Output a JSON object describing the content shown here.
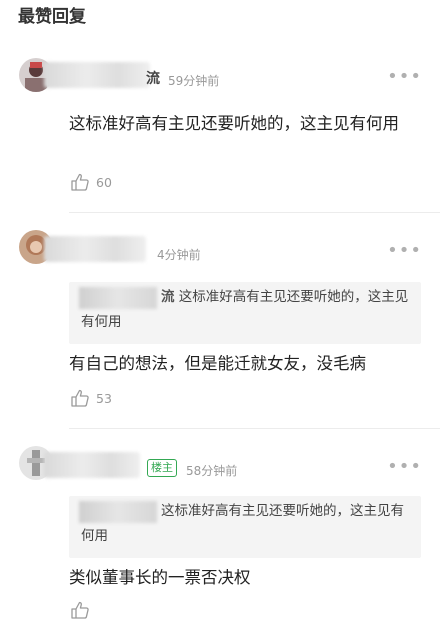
{
  "section_title": "最赞回复",
  "comments": [
    {
      "name_tail": "流",
      "time": "59分钟前",
      "text": "这标准好高有主见还要听她的，这主见有何用",
      "likes": "60"
    },
    {
      "name_tail": "",
      "time": "4分钟前",
      "quote_name_tail": "流",
      "quote_text": "这标准好高有主见还要听她的，这主见有何用",
      "text": "有自己的想法，但是能迁就女友，没毛病",
      "likes": "53"
    },
    {
      "name_tail": "",
      "badge": "楼主",
      "time": "58分钟前",
      "quote_name_tail": "",
      "quote_text": "这标准好高有主见还要听她的，这主见有何用",
      "text": "类似董事长的一票否决权",
      "likes": ""
    }
  ],
  "icons": {
    "like": "thumbs-up-icon",
    "more": "more-horizontal-icon"
  },
  "colors": {
    "badge": "#34a853",
    "meta": "#999999",
    "quote_bg": "#f4f4f4"
  }
}
